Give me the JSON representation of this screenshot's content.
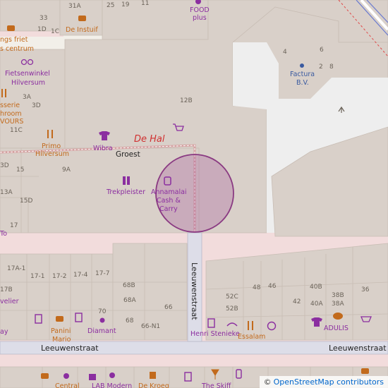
{
  "map": {
    "colors": {
      "background": "#f2efe9",
      "building": "#d9d0c9",
      "pedestrian_area": "#f2dcdc",
      "parking": "#eeeeee",
      "road": "#dddde8",
      "poi_purple": "#8b2ea0",
      "poi_orange": "#c26a1c",
      "highlight_circle": "#a04a96"
    },
    "streets": {
      "leeuwenstraat_vertical": "Leeuwenstraat",
      "leeuwenstraat_left": "Leeuwenstraat",
      "leeuwenstraat_right": "Leeuwenstraat",
      "groest": "Groest",
      "de_hal": "De Hal"
    },
    "pois": {
      "food_plus_1": "FOOD",
      "food_plus_2": "plus",
      "de_instuif": "De Instuif",
      "kings_friet_1": "ngs friet",
      "kings_friet_2": "s centrum",
      "fietsenwinkel_1": "Fietsenwinkel",
      "fietsenwinkel_2": "Hilversum",
      "brasserie": "sserie",
      "showroom": "hroom",
      "yours": "VOURS",
      "primo_1": "Primo",
      "primo_2": "Hilversum",
      "wibra": "Wibra",
      "trekpleister": "Trekpleister",
      "annamalai_1": "Annamalai",
      "annamalai_2": "Cash &",
      "annamalai_3": "Carry",
      "factura_1": "Factura",
      "factura_2": "B.V.",
      "velier": "velier",
      "ay": "ay",
      "panini_1": "Panini",
      "panini_2": "Mario",
      "diamant": "Diamant",
      "henri_stenieke": "Henri Stenieke",
      "essalam": "Essalam",
      "adulis": "ADULIS",
      "central": "Central",
      "lab_modern": "LAB Modern",
      "de_kroeg": "De Kroeg",
      "the_skiff": "The Skiff",
      "to": "To"
    },
    "house_numbers": {
      "n33": "33",
      "n31a": "31A",
      "n25": "25",
      "n19": "19",
      "n11": "11",
      "n1d": "1D",
      "n1c": "1C",
      "n4": "4",
      "n6": "6",
      "n2": "2",
      "n8": "8",
      "n12b": "12B",
      "n3a": "3A",
      "n3d": "3D",
      "n11c": "11C",
      "n3d2": "3D",
      "n15": "15",
      "n9a": "9A",
      "n13a": "13A",
      "n15d": "15D",
      "n17": "17",
      "n17a1": "17A-1",
      "n17_1": "17-1",
      "n17_2": "17-2",
      "n17_4": "17-4",
      "n17_7": "17-7",
      "n17b": "17B",
      "n68b": "68B",
      "n68a": "68A",
      "n70": "70",
      "n66": "66",
      "n68": "68",
      "n66n1": "66-N1",
      "n48": "48",
      "n46": "46",
      "n52c": "52C",
      "n52b": "52B",
      "n42": "42",
      "n40b": "40B",
      "n40a": "40A",
      "n38b": "38B",
      "n38a": "38A",
      "n36": "36"
    },
    "attribution": {
      "copyright": "©",
      "text": "OpenStreetMap contributors"
    }
  }
}
